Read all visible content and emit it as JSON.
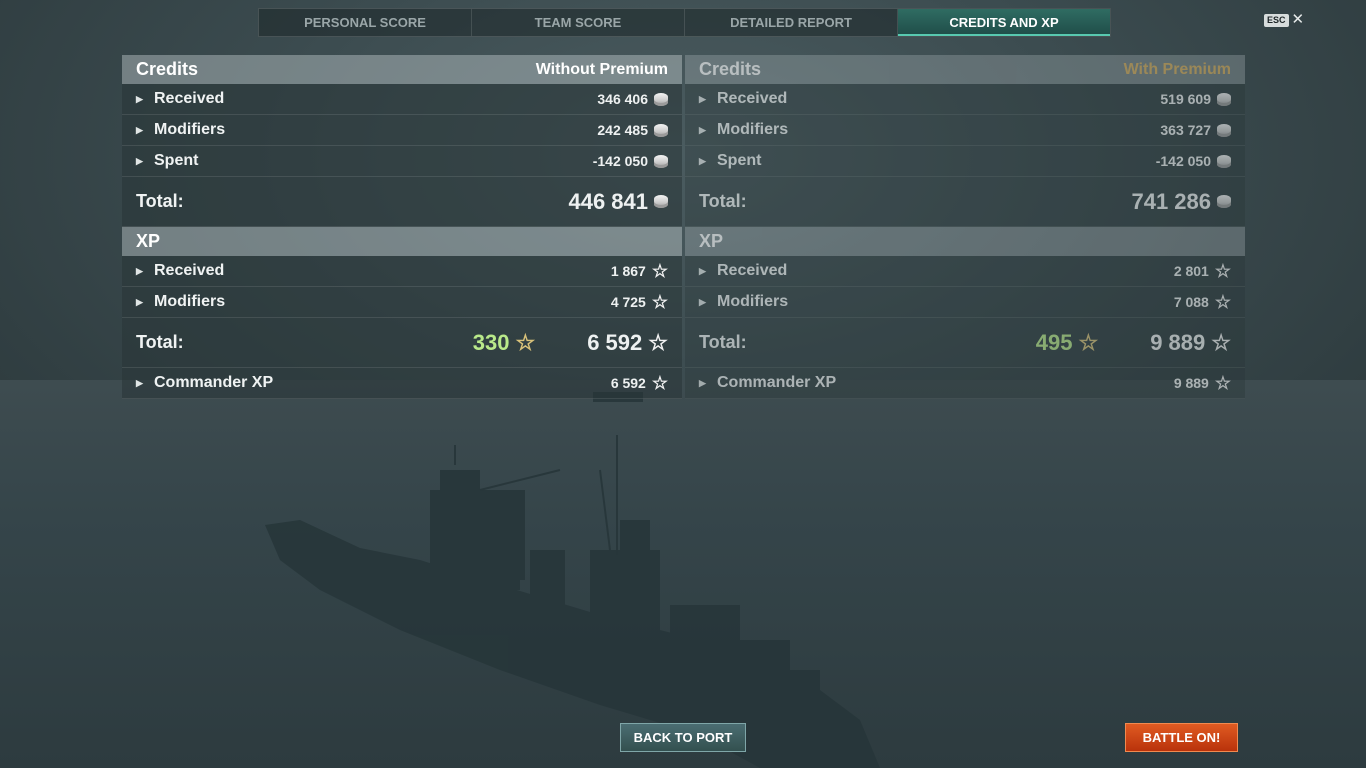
{
  "tabs": [
    {
      "label": "PERSONAL SCORE"
    },
    {
      "label": "TEAM SCORE"
    },
    {
      "label": "DETAILED REPORT"
    },
    {
      "label": "CREDITS AND XP"
    }
  ],
  "esc": {
    "key": "ESC",
    "close": "✕"
  },
  "left": {
    "credits": {
      "title": "Credits",
      "mode": "Without Premium",
      "received": {
        "label": "Received",
        "value": "346 406"
      },
      "modifiers": {
        "label": "Modifiers",
        "value": "242 485"
      },
      "spent": {
        "label": "Spent",
        "value": "-142 050"
      },
      "total": {
        "label": "Total:",
        "value": "446 841"
      }
    },
    "xp": {
      "title": "XP",
      "received": {
        "label": "Received",
        "value": "1 867"
      },
      "modifiers": {
        "label": "Modifiers",
        "value": "4 725"
      },
      "total": {
        "label": "Total:",
        "free": "330",
        "value": "6 592"
      },
      "commander": {
        "label": "Commander XP",
        "value": "6 592"
      }
    }
  },
  "right": {
    "credits": {
      "title": "Credits",
      "mode": "With Premium",
      "received": {
        "label": "Received",
        "value": "519 609"
      },
      "modifiers": {
        "label": "Modifiers",
        "value": "363 727"
      },
      "spent": {
        "label": "Spent",
        "value": "-142 050"
      },
      "total": {
        "label": "Total:",
        "value": "741 286"
      }
    },
    "xp": {
      "title": "XP",
      "received": {
        "label": "Received",
        "value": "2 801"
      },
      "modifiers": {
        "label": "Modifiers",
        "value": "7 088"
      },
      "total": {
        "label": "Total:",
        "free": "495",
        "value": "9 889"
      },
      "commander": {
        "label": "Commander XP",
        "value": "9 889"
      }
    }
  },
  "buttons": {
    "back": "BACK TO PORT",
    "battle": "BATTLE ON!"
  },
  "colors": {
    "accent": "#58c9b0",
    "premium": "#d8b060",
    "battle": "#d9461a",
    "free_xp": "#b9e98a"
  },
  "icons": {
    "credit": "silver-coin-icon",
    "xp": "star-icon",
    "expand": "expand-arrow-icon"
  }
}
